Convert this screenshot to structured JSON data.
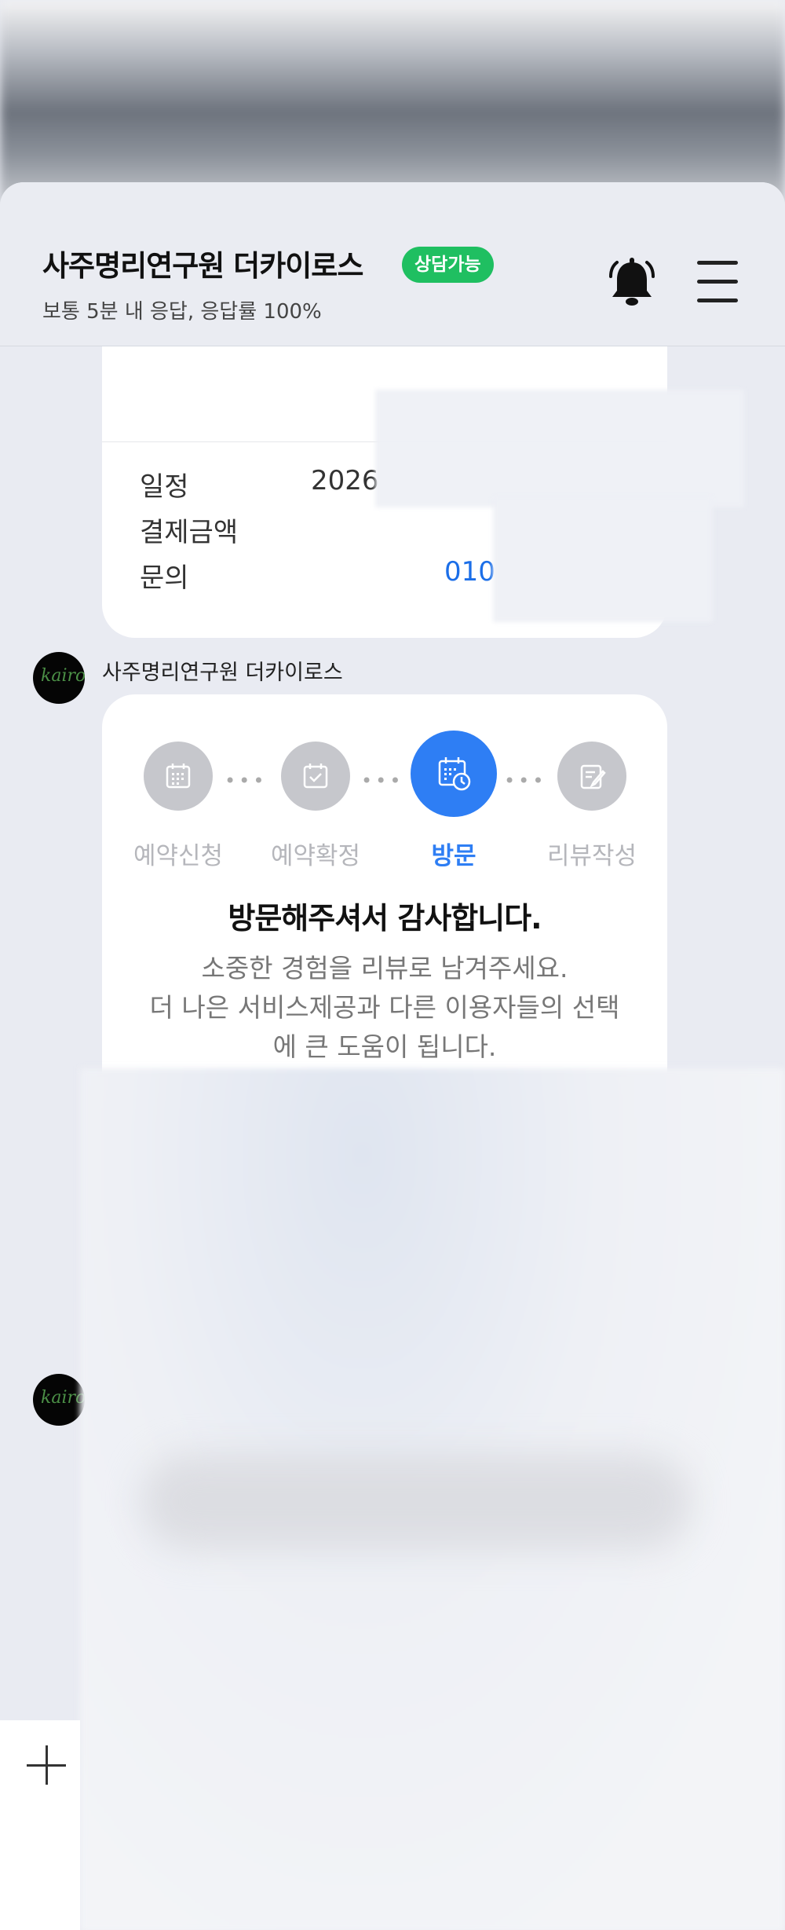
{
  "header": {
    "title": "사주명리연구원 더카이로스",
    "status_badge": "상담가능",
    "response_info": "보통 5분 내 응답, 응답률 100%"
  },
  "reservation": {
    "rows": [
      {
        "label": "일정",
        "value": "2026"
      },
      {
        "label": "결제금액",
        "value": ""
      },
      {
        "label": "문의",
        "value": "010"
      }
    ]
  },
  "message": {
    "sender": "사주명리연구원 더카이로스",
    "avatar_text": "kairo",
    "steps": [
      {
        "label": "예약신청",
        "icon": "calendar-grid-icon",
        "state": "done"
      },
      {
        "label": "예약확정",
        "icon": "calendar-check-icon",
        "state": "done"
      },
      {
        "label": "방문",
        "icon": "calendar-clock-icon",
        "state": "current"
      },
      {
        "label": "리뷰작성",
        "icon": "edit-note-icon",
        "state": "pending"
      }
    ],
    "title": "방문해주셔서 감사합니다.",
    "desc_line1": "소중한 경험을 리뷰로 남겨주세요.",
    "desc_line2": "더 나은 서비스제공과 다른 이용자들의 선택",
    "desc_line3": "에 큰 도움이 됩니다."
  },
  "second_avatar_text": "kairo",
  "colors": {
    "badge": "#1fbf61",
    "accent": "#2e7ef4",
    "link": "#1b6ee8",
    "background": "#e9ebf2"
  }
}
